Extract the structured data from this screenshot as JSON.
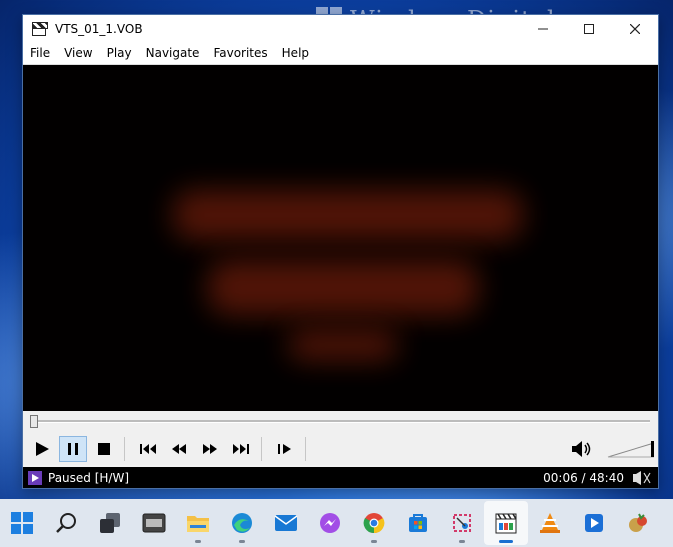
{
  "watermark": {
    "text": "WindowsDigital.com"
  },
  "window": {
    "title": "VTS_01_1.VOB",
    "app_icon": "clapperboard-icon",
    "controls": {
      "minimize": "minimize-icon",
      "maximize": "maximize-icon",
      "close": "close-icon"
    }
  },
  "menu": {
    "items": [
      {
        "label": "File"
      },
      {
        "label": "View"
      },
      {
        "label": "Play"
      },
      {
        "label": "Navigate"
      },
      {
        "label": "Favorites"
      },
      {
        "label": "Help"
      }
    ]
  },
  "playback": {
    "position_fraction": 0.002,
    "buttons": [
      {
        "icon": "play-icon",
        "active": false
      },
      {
        "icon": "pause-icon",
        "active": true
      },
      {
        "icon": "stop-icon",
        "active": false
      },
      {
        "icon": "previous-icon",
        "active": false
      },
      {
        "icon": "rewind-icon",
        "active": false
      },
      {
        "icon": "fast-forward-icon",
        "active": false
      },
      {
        "icon": "next-icon",
        "active": false
      },
      {
        "icon": "frame-step-icon",
        "active": false
      }
    ],
    "volume_icon": "speaker-icon"
  },
  "status": {
    "icon": "play-status-icon",
    "text": "Paused [H/W]",
    "time": "00:06 / 48:40"
  },
  "taskbar": {
    "items": [
      {
        "icon": "windows-start-icon",
        "running": false,
        "active": false
      },
      {
        "icon": "search-icon",
        "running": false,
        "active": false
      },
      {
        "icon": "task-view-icon",
        "running": false,
        "active": false
      },
      {
        "icon": "widgets-icon",
        "running": false,
        "active": false
      },
      {
        "icon": "file-explorer-icon",
        "running": true,
        "active": false
      },
      {
        "icon": "edge-icon",
        "running": true,
        "active": false
      },
      {
        "icon": "mail-icon",
        "running": false,
        "active": false
      },
      {
        "icon": "messenger-icon",
        "running": false,
        "active": false
      },
      {
        "icon": "chrome-icon",
        "running": true,
        "active": false
      },
      {
        "icon": "store-icon",
        "running": false,
        "active": false
      },
      {
        "icon": "snipping-tool-icon",
        "running": true,
        "active": false
      },
      {
        "icon": "mpc-hc-icon",
        "running": true,
        "active": true
      },
      {
        "icon": "vlc-icon",
        "running": false,
        "active": false
      },
      {
        "icon": "media-player-icon",
        "running": false,
        "active": false
      },
      {
        "icon": "app-icon",
        "running": false,
        "active": false
      }
    ]
  },
  "colors": {
    "titlebar": "#ffffff",
    "video_background": "#020000",
    "status_background": "#000000",
    "accent": "#1a6fd0"
  }
}
